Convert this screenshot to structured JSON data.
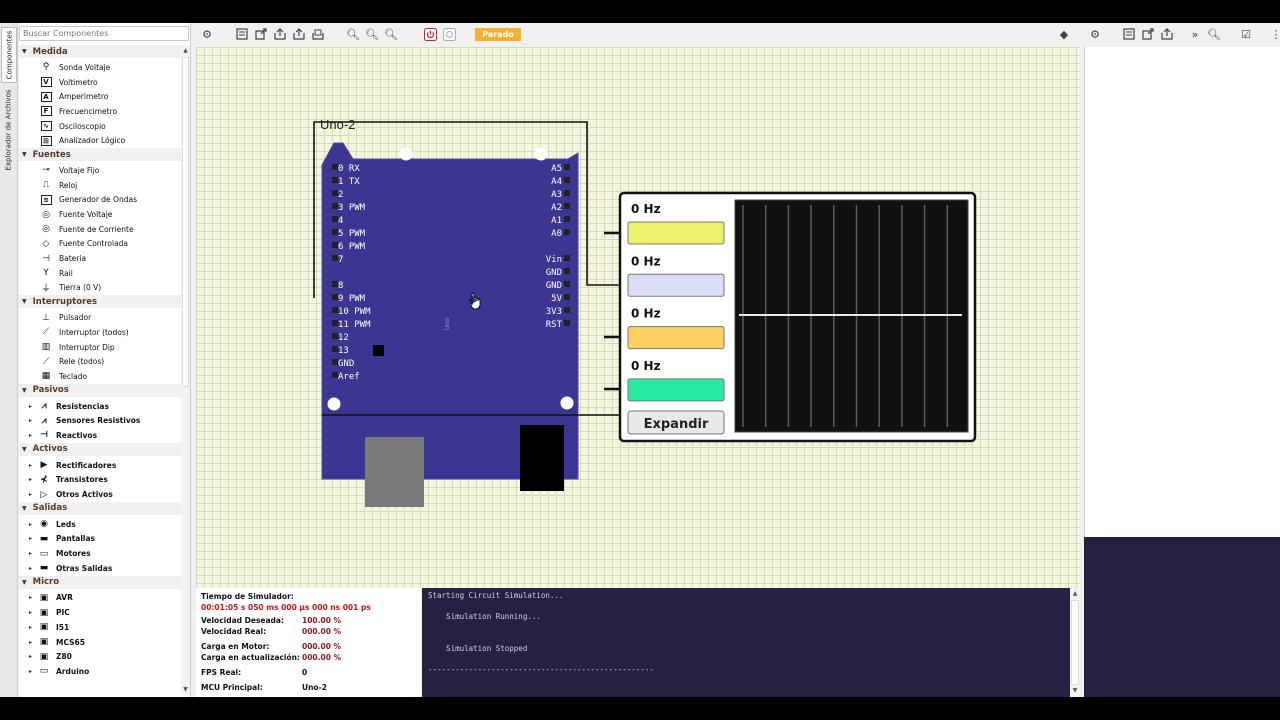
{
  "tabs": {
    "components": "Componentes",
    "files": "Explorador de Archivos"
  },
  "search": {
    "placeholder": "Buscar Componentes"
  },
  "tree": [
    {
      "category": "Medida",
      "items": [
        {
          "label": "Sonda Voltaje",
          "icon": "probe-icon"
        },
        {
          "label": "Voltimetro",
          "icon": "voltmeter-icon"
        },
        {
          "label": "Amperimetro",
          "icon": "ammeter-icon"
        },
        {
          "label": "Frecuencimetro",
          "icon": "frequency-meter-icon"
        },
        {
          "label": "Osciloscopio",
          "icon": "oscilloscope-icon"
        },
        {
          "label": "Analizador Lógico",
          "icon": "logic-analyzer-icon"
        }
      ]
    },
    {
      "category": "Fuentes",
      "items": [
        {
          "label": "Voltaje Fijo",
          "icon": "fixed-voltage-icon"
        },
        {
          "label": "Reloj",
          "icon": "clock-icon"
        },
        {
          "label": "Generador de Ondas",
          "icon": "wave-generator-icon"
        },
        {
          "label": "Fuente Voltaje",
          "icon": "voltage-source-icon"
        },
        {
          "label": "Fuente de Corriente",
          "icon": "current-source-icon"
        },
        {
          "label": "Fuente Controlada",
          "icon": "controlled-source-icon"
        },
        {
          "label": "Bateria",
          "icon": "battery-icon"
        },
        {
          "label": "Rail",
          "icon": "rail-icon"
        },
        {
          "label": "Tierra (0 V)",
          "icon": "ground-icon"
        }
      ]
    },
    {
      "category": "Interruptores",
      "items": [
        {
          "label": "Pulsador",
          "icon": "push-button-icon"
        },
        {
          "label": "Interruptor (todos)",
          "icon": "switch-icon"
        },
        {
          "label": "Interruptor Dip",
          "icon": "dip-switch-icon"
        },
        {
          "label": "Rele (todos)",
          "icon": "relay-icon"
        },
        {
          "label": "Teclado",
          "icon": "keypad-icon"
        }
      ]
    },
    {
      "category": "Pasivos",
      "sub": true,
      "items": [
        {
          "label": "Resistencias",
          "icon": "resistor-icon"
        },
        {
          "label": "Sensores Resistivos",
          "icon": "resistive-sensor-icon"
        },
        {
          "label": "Reactivos",
          "icon": "reactive-icon"
        }
      ]
    },
    {
      "category": "Activos",
      "sub": true,
      "items": [
        {
          "label": "Rectificadores",
          "icon": "rectifier-icon"
        },
        {
          "label": "Transistores",
          "icon": "transistor-icon"
        },
        {
          "label": "Otros Activos",
          "icon": "other-active-icon"
        }
      ]
    },
    {
      "category": "Salidas",
      "sub": true,
      "items": [
        {
          "label": "Leds",
          "icon": "led-icon"
        },
        {
          "label": "Pantallas",
          "icon": "display-icon"
        },
        {
          "label": "Motores",
          "icon": "motor-icon"
        },
        {
          "label": "Otras Salidas",
          "icon": "other-output-icon"
        }
      ]
    },
    {
      "category": "Micro",
      "sub": true,
      "items": [
        {
          "label": "AVR",
          "icon": "chip-icon"
        },
        {
          "label": "PIC",
          "icon": "chip-icon"
        },
        {
          "label": "I51",
          "icon": "chip-icon"
        },
        {
          "label": "MCS65",
          "icon": "chip-icon"
        },
        {
          "label": "Z80",
          "icon": "chip-icon"
        },
        {
          "label": "Arduino",
          "icon": "arduino-icon"
        }
      ]
    }
  ],
  "toolbar": {
    "status": "Parado",
    "status_color": "#f6b12e"
  },
  "board": {
    "title": "Uno-2",
    "chip_label": "Uno",
    "left_pins": [
      "0 RX",
      "1 TX",
      "2",
      "3 PWM",
      "4",
      "5 PWM",
      "6 PWM",
      "7",
      "8",
      "9 PWM",
      "10 PWM",
      "11 PWM",
      "12",
      "13",
      "GND",
      "Aref"
    ],
    "right_pins_a": [
      "A5",
      "A4",
      "A3",
      "A2",
      "A1",
      "A0"
    ],
    "right_pins_b": [
      "Vin",
      "GND",
      "GND",
      "5V",
      "3V3",
      "RST"
    ],
    "color": "#3b3691"
  },
  "scope": {
    "channels": [
      {
        "freq": "0 Hz",
        "color": "#ecf06a"
      },
      {
        "freq": "0 Hz",
        "color": "#dcdcf7"
      },
      {
        "freq": "0 Hz",
        "color": "#ffcf5f"
      },
      {
        "freq": "0 Hz",
        "color": "#27eaa3"
      }
    ],
    "expand_label": "Expandir"
  },
  "stats": {
    "sim_time_label": "Tiempo de Simulador:",
    "sim_time_value": "00:01:05 s  050 ms  000 µs  000 ns  001 ps",
    "rows": [
      {
        "label": "Velocidad Deseada:",
        "value": "100.00 %"
      },
      {
        "label": "Velocidad Real:",
        "value": "000.00 %"
      },
      {
        "label": "Carga en Motor:",
        "value": "000.00 %"
      },
      {
        "label": "Carga en actualización:",
        "value": "000.00 %"
      },
      {
        "label": "FPS Real:",
        "value": "0"
      },
      {
        "label": "MCU Principal:",
        "value": "Uno-2"
      }
    ]
  },
  "console": {
    "lines": [
      "Starting Circuit Simulation...",
      "    Simulation Running...",
      "    Simulation Stopped",
      "--------------------------------------------------"
    ]
  }
}
